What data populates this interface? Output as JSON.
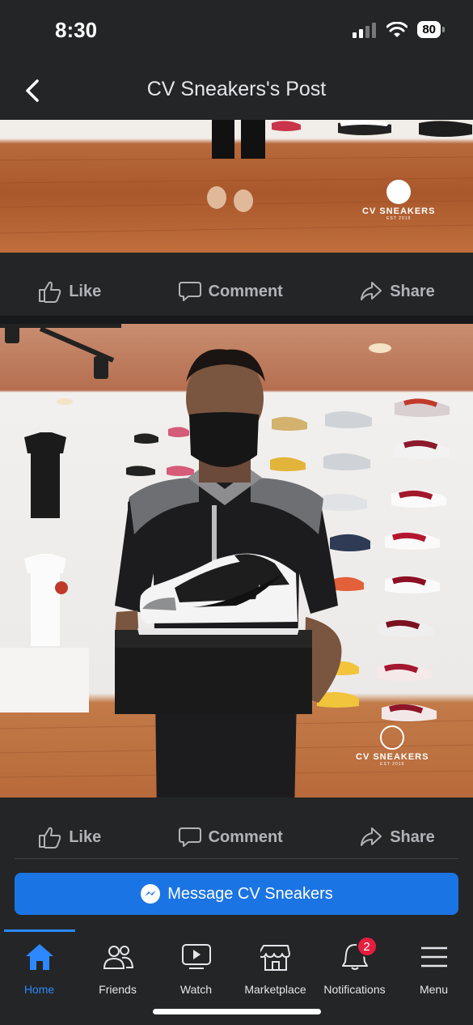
{
  "status_bar": {
    "time": "8:30",
    "battery": "80"
  },
  "header": {
    "title": "CV Sneakers's Post"
  },
  "watermark": {
    "name": "CV SNEAKERS",
    "est": "EST 2019"
  },
  "post_actions": {
    "like": "Like",
    "comment": "Comment",
    "share": "Share"
  },
  "message_button": {
    "label": "Message CV Sneakers"
  },
  "tabs": [
    {
      "label": "Home",
      "icon": "home-icon",
      "active": true
    },
    {
      "label": "Friends",
      "icon": "friends-icon"
    },
    {
      "label": "Watch",
      "icon": "watch-icon"
    },
    {
      "label": "Marketplace",
      "icon": "marketplace-icon"
    },
    {
      "label": "Notifications",
      "icon": "bell-icon",
      "badge": "2"
    },
    {
      "label": "Menu",
      "icon": "menu-icon"
    }
  ],
  "colors": {
    "accent": "#2d88ff",
    "button": "#1b74e4",
    "badge": "#e41e3f",
    "background": "#242526"
  }
}
